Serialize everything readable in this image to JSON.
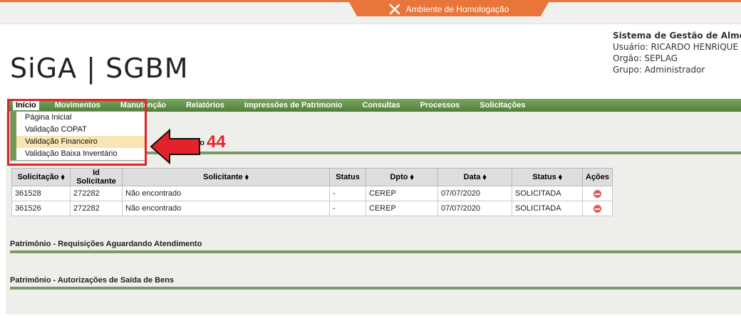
{
  "environment": {
    "label": "Ambiente de Homologação"
  },
  "logo": {
    "text": "SiGA | SGBM"
  },
  "system": {
    "title": "Sistema de Gestão de Almox",
    "user": "Usuário: RICARDO HENRIQUE F",
    "org": "Orgão: SEPLAG",
    "group": "Grupo: Administrador"
  },
  "nav": {
    "items": [
      "Início",
      "Movimentos",
      "Manutenção",
      "Relatórios",
      "Impressões de Patrimonio",
      "Consultas",
      "Processos",
      "Solicitações"
    ]
  },
  "dropdown": {
    "items": [
      "Página Inicial",
      "Validação COPAT",
      "Validação Financeiro",
      "Validação Baixa Inventário"
    ],
    "highlighted": "Validação Financeiro"
  },
  "annotation": {
    "number": "44",
    "partial_text": "nto"
  },
  "table": {
    "headers": [
      "Solicitação ⬧",
      "Id Solicitante",
      "Solicitante ⬧",
      "Status",
      "Dpto ⬧",
      "Data ⬧",
      "Status ⬧",
      "Ações"
    ],
    "rows": [
      [
        "361528",
        "272282",
        "Não encontrado",
        "-",
        "CEREP",
        "07/07/2020",
        "SOLICITADA"
      ],
      [
        "361526",
        "272282",
        "Não encontrado",
        "-",
        "CEREP",
        "07/07/2020",
        "SOLICITADA"
      ]
    ]
  },
  "sections": {
    "requisicoes": "Patrimônio - Requisições Aguardando Atendimento",
    "autorizacoes": "Patrimônio - Autorizações de Saída de Bens"
  },
  "colors": {
    "accent": "#e8763a",
    "nav": "#5f8f45",
    "highlight": "#e3232a"
  }
}
